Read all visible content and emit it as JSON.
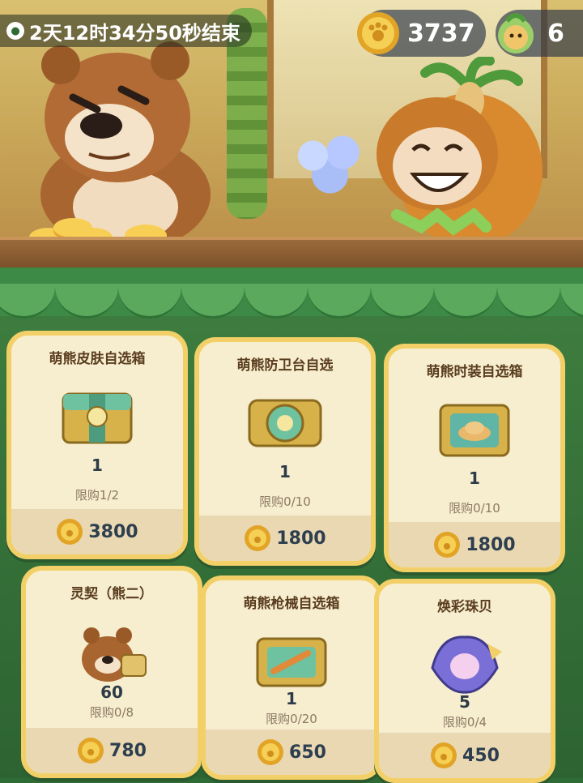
{
  "timer": {
    "text": "2天12时34分50秒结束",
    "icon": "paw-icon"
  },
  "currency": {
    "amount": "3737",
    "icon": "coin-icon"
  },
  "pet_currency": {
    "amount": "6",
    "icon": "pet-avatar-icon"
  },
  "colors": {
    "card_border": "#f3d067",
    "card_bg": "#f7edcf",
    "shop_bg": "#2d6332",
    "price_text": "#2d3e4e"
  },
  "shop_items": [
    {
      "title": "萌熊皮肤自选箱",
      "qty": "1",
      "limit": "限购1/2",
      "price": "3800",
      "icon": "skin-chest-icon"
    },
    {
      "title": "萌熊防卫台自选",
      "qty": "1",
      "limit": "限购0/10",
      "price": "1800",
      "icon": "defense-chest-icon"
    },
    {
      "title": "萌熊时装自选箱",
      "qty": "1",
      "limit": "限购0/10",
      "price": "1800",
      "icon": "outfit-chest-icon"
    },
    {
      "title": "灵契（熊二）",
      "qty": "60",
      "limit": "限购0/8",
      "price": "780",
      "icon": "bear-token-icon"
    },
    {
      "title": "萌熊枪械自选箱",
      "qty": "1",
      "limit": "限购0/20",
      "price": "650",
      "icon": "weapon-chest-icon"
    },
    {
      "title": "焕彩珠贝",
      "qty": "5",
      "limit": "限购0/4",
      "price": "450",
      "icon": "pearl-shell-icon"
    }
  ]
}
